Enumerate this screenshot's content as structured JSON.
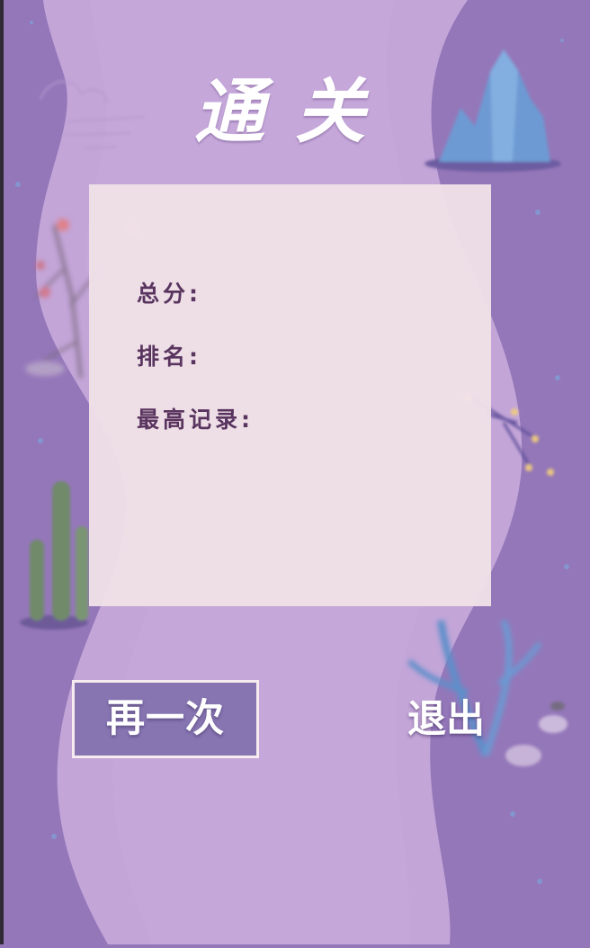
{
  "title": "通关",
  "result_card": {
    "total_score_label": "总分:",
    "rank_label": "排名:",
    "best_record_label": "最高记录:"
  },
  "actions": {
    "retry_label": "再一次",
    "exit_label": "退出"
  },
  "colors": {
    "background_purple": "#9477b9",
    "river_lilac": "#c3a5d8",
    "card_pink": "#f0e2e8",
    "label_text": "#59345f",
    "retry_button_bg": "#8675b1"
  }
}
